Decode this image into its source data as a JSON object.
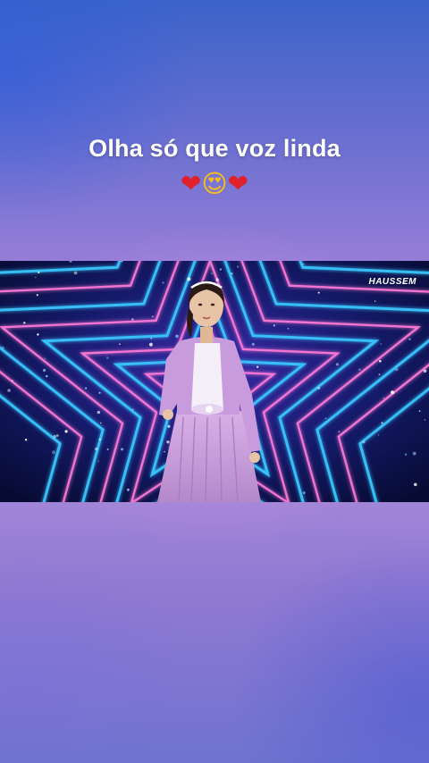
{
  "caption": {
    "text": "Olha só que voz linda",
    "emojis": [
      "❤",
      "😍",
      "❤"
    ]
  },
  "video": {
    "watermark": "HAUSSEM"
  },
  "colors": {
    "heart": "#e0202b",
    "star_neon_pink": "#ff7ad8",
    "star_neon_blue": "#38c8ff",
    "dress": "#c99ad9"
  }
}
